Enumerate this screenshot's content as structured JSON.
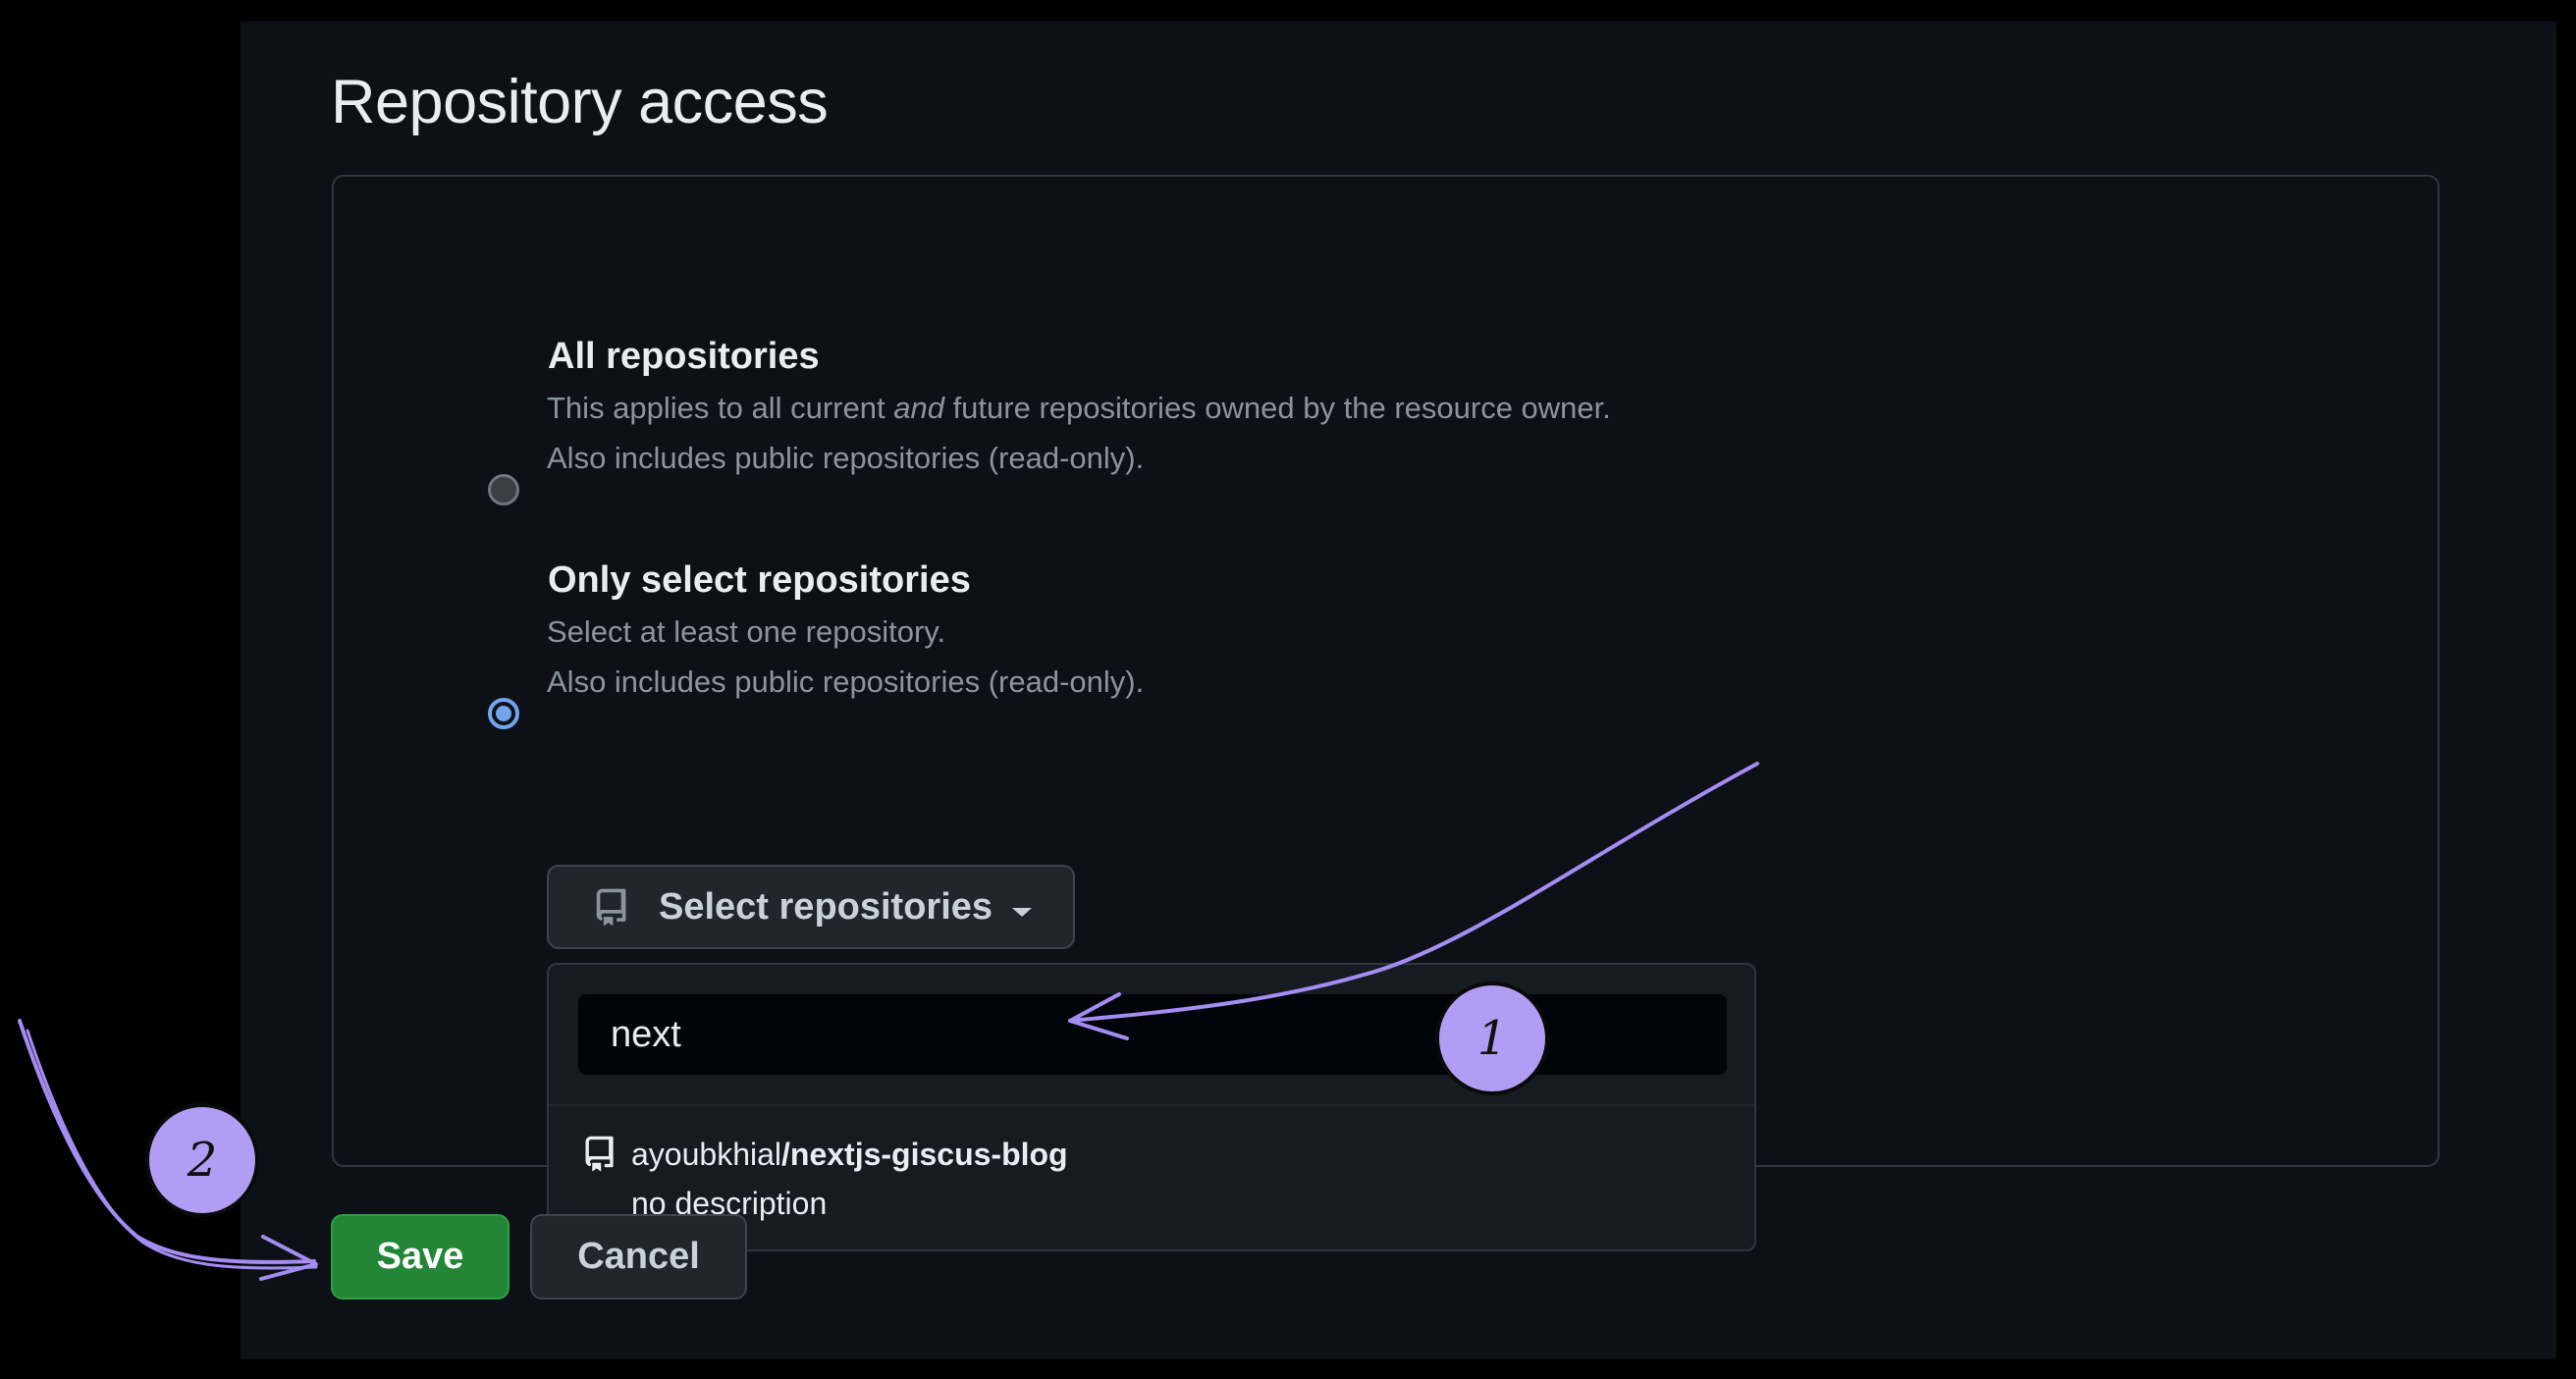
{
  "page": {
    "title": "Repository access",
    "options": [
      {
        "label": "All repositories",
        "selected": false,
        "desc_line1_pre": "This applies to all current ",
        "desc_line1_em": "and",
        "desc_line1_post": " future repositories owned by the resource owner.",
        "desc_line2": "Also includes public repositories (read-only)."
      },
      {
        "label": "Only select repositories",
        "selected": true,
        "desc_line1": "Select at least one repository.",
        "desc_line2": "Also includes public repositories (read-only)."
      }
    ],
    "select_button": {
      "label": "Select repositories",
      "icon": "repo-icon"
    },
    "dropdown": {
      "search_value": "next",
      "results": [
        {
          "owner": "ayoubkhial",
          "repo": "/nextjs-giscus-blog",
          "description": "no description",
          "icon": "repo-icon"
        }
      ]
    },
    "actions": {
      "save": "Save",
      "cancel": "Cancel"
    }
  },
  "annotations": {
    "color": "#b19df3",
    "badges": [
      {
        "label": "1"
      },
      {
        "label": "2"
      }
    ]
  },
  "colors": {
    "background": "#0d1117",
    "accent_radio": "#74a4ee",
    "save_button": "#238636"
  }
}
